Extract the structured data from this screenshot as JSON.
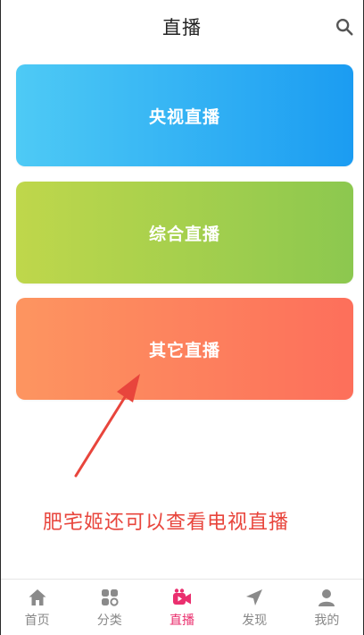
{
  "header": {
    "title": "直播",
    "search_icon": "search-icon"
  },
  "cards": [
    {
      "label": "央视直播",
      "colors": [
        "#4ecaf5",
        "#1b9cf2"
      ]
    },
    {
      "label": "综合直播",
      "colors": [
        "#bfd74b",
        "#8cc84f"
      ]
    },
    {
      "label": "其它直播",
      "colors": [
        "#fd9560",
        "#fd6f5b"
      ]
    }
  ],
  "annotation": {
    "text": "肥宅姬还可以查看电视直播",
    "color": "#e8453c"
  },
  "tabbar": {
    "active_color": "#ea2f6e",
    "items": [
      {
        "label": "首页",
        "icon": "home-icon"
      },
      {
        "label": "分类",
        "icon": "category-icon"
      },
      {
        "label": "直播",
        "icon": "live-camera-icon",
        "active": true
      },
      {
        "label": "发现",
        "icon": "discover-icon"
      },
      {
        "label": "我的",
        "icon": "profile-icon"
      }
    ]
  }
}
